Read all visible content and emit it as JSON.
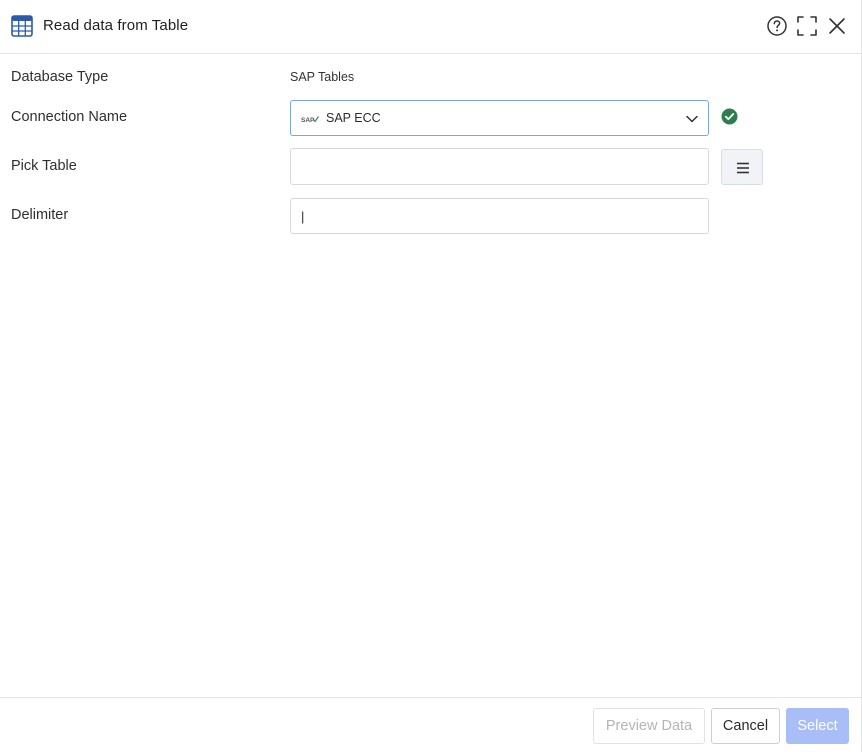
{
  "dialog": {
    "title": "Read data from Table",
    "icons": {
      "header": "table-grid-icon",
      "help": "help-circle-icon",
      "maximize": "maximize-icon",
      "close": "close-icon"
    }
  },
  "form": {
    "database_type": {
      "label": "Database Type",
      "value": "SAP Tables"
    },
    "connection_name": {
      "label": "Connection Name",
      "value": "SAP ECC",
      "logo": "SAP",
      "status_icon": "check-circle-icon",
      "status_color": "#2e7d4f"
    },
    "pick_table": {
      "label": "Pick Table",
      "value": "",
      "button_icon": "list-menu-icon"
    },
    "delimiter": {
      "label": "Delimiter",
      "value": "|"
    }
  },
  "footer": {
    "preview_label": "Preview Data",
    "cancel_label": "Cancel",
    "select_label": "Select"
  },
  "colors": {
    "accent": "#a9bdf6",
    "focus_border": "#7aa6e6",
    "icon_blue": "#2e5aa8"
  }
}
